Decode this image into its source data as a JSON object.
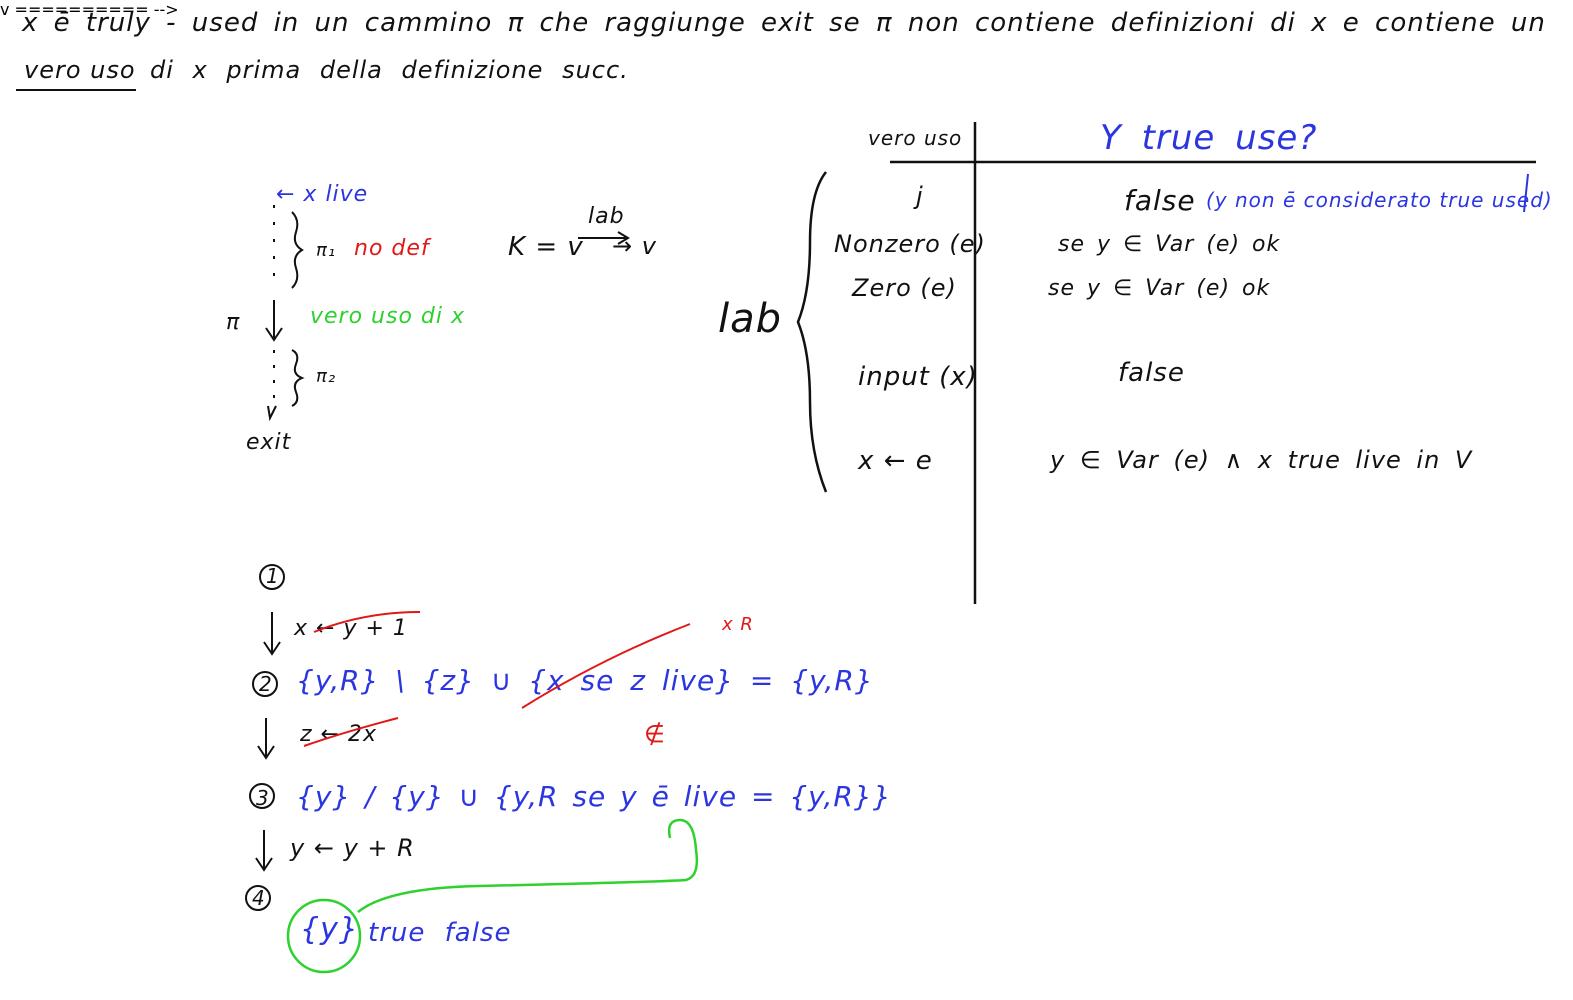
{
  "intro": {
    "line1": "x ē truly - used  in un cammino π che raggiunge exit se π non contiene definizioni di x e contiene un",
    "line2_underlined": "vero uso",
    "line2_rest": "di x  prima della definizione succ."
  },
  "path_diagram": {
    "x_live": "← x live",
    "pi1_label": "π₁",
    "pi1_note": "no def",
    "pi_label": "π",
    "vero_uso": "vero uso di x",
    "pi2_label": "π₂",
    "exit": "exit"
  },
  "formula": {
    "k": "K = v",
    "lab": "lab",
    "arrow_target": "→ v"
  },
  "table": {
    "brace_label": "lab",
    "col1_header": "vero uso",
    "col2_header": "Y true use?",
    "rows": [
      {
        "label": "j",
        "value": "false",
        "note": "(y non ē considerato true used)"
      },
      {
        "label": "Nonzero (e)",
        "value": "se y ∈ Var (e)  ok",
        "note": ""
      },
      {
        "label": "Zero (e)",
        "value": "se y ∈ Var (e)  ok",
        "note": ""
      },
      {
        "label": "input (x)",
        "value": "false",
        "note": ""
      },
      {
        "label": "x ← e",
        "value": "y ∈ Var (e)  ∧  x true live  in  V",
        "note": ""
      }
    ]
  },
  "example": {
    "node1": "1",
    "edge1": "x ← y + 1",
    "annot_xr": "x R",
    "node2": "2",
    "set2": "{y,R} \\ {z} ∪ {x se z live} = {y,R}",
    "edge2": "z ← 2x",
    "annot_notin": "∉",
    "node3": "3",
    "set3": "{y} / {y} ∪ {y,R  se  y ē  live   =  {y,R}}",
    "edge3": "y ← y + R",
    "node4": "4",
    "set4_circled": "{y}",
    "set4_rest": "true  false"
  }
}
